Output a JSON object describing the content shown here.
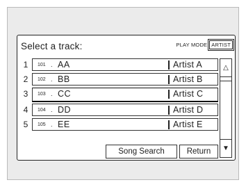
{
  "title": "Select a track:",
  "play_mode_label": "PLAY MODE",
  "play_mode_button": "ARTIST",
  "tracks": [
    {
      "num": "1",
      "code": "101",
      "name": "AA",
      "artist": "Artist A"
    },
    {
      "num": "2",
      "code": "102",
      "name": "BB",
      "artist": "Artist B"
    },
    {
      "num": "3",
      "code": "103",
      "name": "CC",
      "artist": "Artist C"
    },
    {
      "num": "4",
      "code": "104",
      "name": "DD",
      "artist": "Artist D"
    },
    {
      "num": "5",
      "code": "105",
      "name": "EE",
      "artist": "Artist E"
    }
  ],
  "buttons": {
    "song_search": "Song Search",
    "return": "Return"
  },
  "icons": {
    "scroll_up": "triangle-up-icon",
    "scroll_down": "triangle-down-icon"
  }
}
